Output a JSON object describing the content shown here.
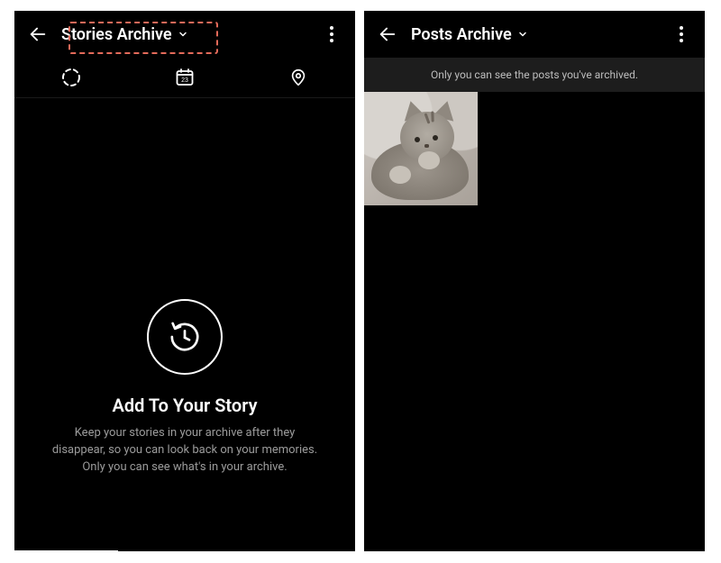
{
  "left": {
    "header": {
      "title": "Stories Archive"
    },
    "tabs": {
      "items": [
        {
          "icon": "story-ring-icon"
        },
        {
          "icon": "calendar-icon",
          "day": "23"
        },
        {
          "icon": "location-pin-icon"
        }
      ],
      "active_index": 0
    },
    "empty": {
      "heading": "Add To Your Story",
      "body": "Keep your stories in your archive after they disappear, so you can look back on your memories. Only you can see what's in your archive."
    },
    "highlight_color": "#e36a5a"
  },
  "right": {
    "header": {
      "title": "Posts Archive"
    },
    "banner": "Only you can see the posts you've archived.",
    "grid": {
      "items": [
        {
          "alt": "kitten-photo"
        }
      ]
    }
  }
}
